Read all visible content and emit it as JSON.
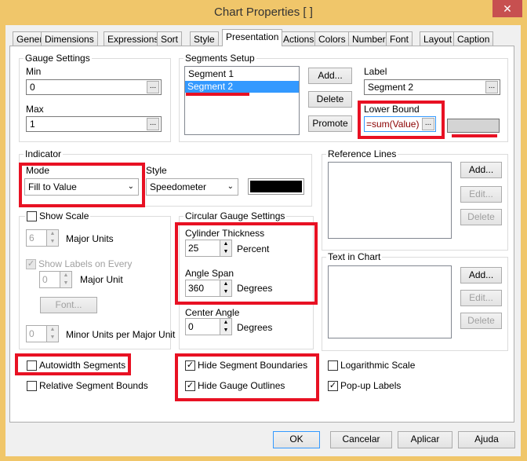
{
  "window": {
    "title": "Chart Properties [ ]",
    "close": "✕"
  },
  "tabs": [
    "General",
    "Dimensions",
    "Expressions",
    "Sort",
    "Style",
    "Presentation",
    "Actions",
    "Colors",
    "Number",
    "Font",
    "Layout",
    "Caption"
  ],
  "gauge_settings": {
    "title": "Gauge Settings",
    "min_label": "Min",
    "min_value": "0",
    "max_label": "Max",
    "max_value": "1",
    "dots": "..."
  },
  "segments_setup": {
    "title": "Segments Setup",
    "items": [
      "Segment 1",
      "Segment 2"
    ],
    "selected": "Segment 2",
    "add": "Add...",
    "delete": "Delete",
    "promote": "Promote",
    "label_label": "Label",
    "label_value": "Segment 2",
    "lower_bound_label": "Lower Bound",
    "lower_bound_value": "=sum(Value)",
    "segment_color": "#d4d4d4"
  },
  "indicator": {
    "title": "Indicator",
    "mode_label": "Mode",
    "mode_value": "Fill to Value",
    "style_label": "Style",
    "style_value": "Speedometer",
    "color": "#000000"
  },
  "reference_lines": {
    "title": "Reference Lines",
    "add": "Add...",
    "edit": "Edit...",
    "delete": "Delete"
  },
  "show_scale": {
    "label": "Show Scale",
    "checked": false,
    "major_units_value": "6",
    "major_units_label": "Major Units",
    "show_labels_label": "Show Labels on Every",
    "show_labels_checked": true,
    "major_unit_value": "0",
    "major_unit_label": "Major Unit",
    "font": "Font...",
    "minor_units_value": "0",
    "minor_units_label": "Minor Units per Major Unit"
  },
  "circular": {
    "title": "Circular Gauge Settings",
    "cylinder_label": "Cylinder Thickness",
    "cylinder_value": "25",
    "cylinder_unit": "Percent",
    "angle_span_label": "Angle Span",
    "angle_span_value": "360",
    "angle_span_unit": "Degrees",
    "center_angle_label": "Center Angle",
    "center_angle_value": "0",
    "center_angle_unit": "Degrees"
  },
  "text_in_chart": {
    "title": "Text in Chart",
    "add": "Add...",
    "edit": "Edit...",
    "delete": "Delete"
  },
  "checkboxes": {
    "autowidth": "Autowidth Segments",
    "relative": "Relative Segment Bounds",
    "hide_boundaries": "Hide Segment Boundaries",
    "hide_outlines": "Hide Gauge Outlines",
    "logarithmic": "Logarithmic Scale",
    "popup": "Pop-up Labels"
  },
  "footer": {
    "ok": "OK",
    "cancel": "Cancelar",
    "apply": "Aplicar",
    "help": "Ajuda"
  },
  "highlight_color": "#e81123"
}
